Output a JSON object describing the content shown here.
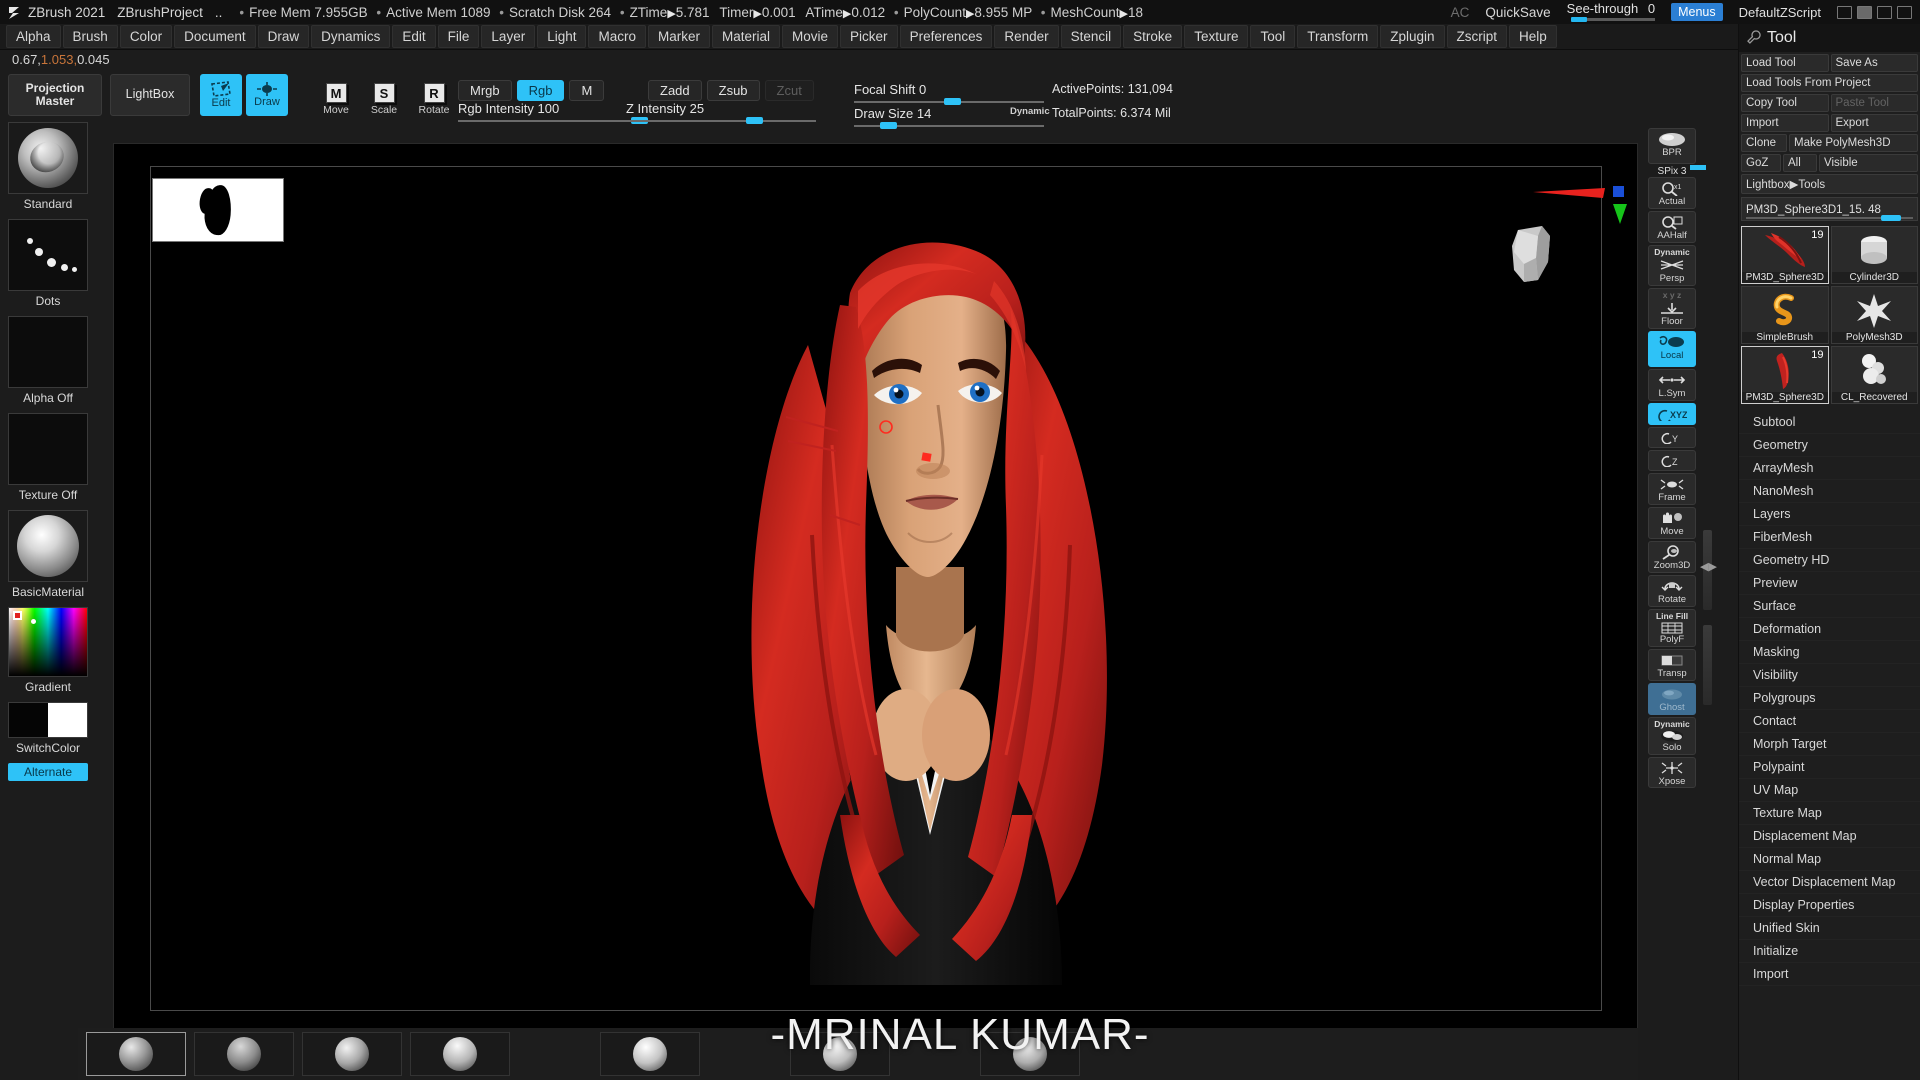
{
  "titlebar": {
    "app": "ZBrush 2021",
    "project": "ZBrushProject",
    "dots": "..",
    "stats": [
      {
        "label": "Free Mem",
        "value": "7.955GB"
      },
      {
        "label": "Active Mem",
        "value": "1089"
      },
      {
        "label": "Scratch Disk",
        "value": "264"
      },
      {
        "label": "ZTime",
        "value": "5.781",
        "arrow": true
      },
      {
        "label": "Timer",
        "value": "0.001",
        "arrow": true
      },
      {
        "label": "ATime",
        "value": "0.012",
        "arrow": true
      },
      {
        "label": "PolyCount",
        "value": "8.955 MP",
        "arrow": true
      },
      {
        "label": "MeshCount",
        "value": "18",
        "arrow": true
      }
    ],
    "ac": "AC",
    "quicksave": "QuickSave",
    "seethrough_label": "See-through",
    "seethrough_value": "0",
    "menus": "Menus",
    "default_zscript": "DefaultZScript"
  },
  "menubar": {
    "items": [
      "Alpha",
      "Brush",
      "Color",
      "Document",
      "Draw",
      "Dynamics",
      "Edit",
      "File",
      "Layer",
      "Light",
      "Macro",
      "Marker",
      "Material",
      "Movie",
      "Picker",
      "Preferences",
      "Render",
      "Stencil",
      "Stroke",
      "Texture",
      "Tool",
      "Transform",
      "Zplugin",
      "Zscript",
      "Help"
    ]
  },
  "coords": {
    "x": "0.67,",
    "y": "1.053,",
    "z": "0.045"
  },
  "toolbar": {
    "projection_master": "Projection Master",
    "lightbox": "LightBox",
    "edit": "Edit",
    "draw": "Draw",
    "move": "Move",
    "scale": "Scale",
    "rotate": "Rotate",
    "mrgb": "Mrgb",
    "rgb": "Rgb",
    "m": "M",
    "zadd": "Zadd",
    "zsub": "Zsub",
    "zcut": "Zcut",
    "rgb_intensity_label": "Rgb Intensity",
    "rgb_intensity_value": "100",
    "z_intensity_label": "Z Intensity",
    "z_intensity_value": "25",
    "focal_shift_label": "Focal Shift",
    "focal_shift_value": "0",
    "draw_size_label": "Draw Size",
    "draw_size_value": "14",
    "dynamic": "Dynamic",
    "active_points": "ActivePoints: 131,094",
    "total_points": "TotalPoints: 6.374 Mil"
  },
  "leftshelf": {
    "brush_label": "Standard",
    "stroke_label": "Dots",
    "alpha_label": "Alpha Off",
    "texture_label": "Texture Off",
    "material_label": "BasicMaterial",
    "gradient_label": "Gradient",
    "switchcolor_label": "SwitchColor",
    "alternate_label": "Alternate"
  },
  "rail": {
    "bpr": "BPR",
    "spix_label": "SPix",
    "spix_value": "3",
    "items": [
      {
        "name": "Actual",
        "active": false
      },
      {
        "name": "AAHalf",
        "active": false
      },
      {
        "name": "Persp",
        "top": "Dynamic",
        "active": false
      },
      {
        "name": "Floor",
        "top": "x y z",
        "active": false
      },
      {
        "name": "Local",
        "active": true
      },
      {
        "name": "L.Sym",
        "active": false
      },
      {
        "name": "XYZ",
        "active": true
      },
      {
        "name": "Y",
        "active": false
      },
      {
        "name": "Z",
        "active": false
      },
      {
        "name": "Frame",
        "active": false
      },
      {
        "name": "Move",
        "active": false
      },
      {
        "name": "Zoom3D",
        "active": false
      },
      {
        "name": "Rotate",
        "active": false
      },
      {
        "name": "PolyF",
        "top": "Line Fill",
        "active": false
      },
      {
        "name": "Transp",
        "active": false
      },
      {
        "name": "Ghost",
        "active": false,
        "ghost": true
      },
      {
        "name": "Solo",
        "top": "Dynamic",
        "active": false
      },
      {
        "name": "Xpose",
        "active": false
      }
    ]
  },
  "toolpanel": {
    "title": "Tool",
    "buttons_row1": [
      "Load Tool",
      "Save As"
    ],
    "buttons_row2": [
      "Load Tools From Project"
    ],
    "buttons_row3": [
      "Copy Tool",
      "Paste Tool"
    ],
    "buttons_row4": [
      "Import",
      "Export"
    ],
    "buttons_row5": [
      "Clone",
      "Make PolyMesh3D"
    ],
    "buttons_row6": [
      "GoZ",
      "All",
      "Visible"
    ],
    "lightbox_tools": "Lightbox▶Tools",
    "slider_label": "PM3D_Sphere3D1_15.",
    "slider_value": "48",
    "tools": [
      {
        "label": "PM3D_Sphere3D",
        "count": "19",
        "selected": true,
        "icon": "red-hair"
      },
      {
        "label": "Cylinder3D",
        "count": "",
        "selected": false,
        "icon": "cylinder"
      },
      {
        "label": "SimpleBrush",
        "count": "",
        "selected": false,
        "icon": "s-brush"
      },
      {
        "label": "PolyMesh3D",
        "count": "",
        "selected": false,
        "icon": "star"
      },
      {
        "label": "PM3D_Sphere3D",
        "count": "19",
        "selected": true,
        "icon": "red-strand"
      },
      {
        "label": "CL_Recovered",
        "count": "",
        "selected": false,
        "icon": "blob"
      }
    ],
    "menu": [
      "Subtool",
      "Geometry",
      "ArrayMesh",
      "NanoMesh",
      "Layers",
      "FiberMesh",
      "Geometry HD",
      "Preview",
      "Surface",
      "Deformation",
      "Masking",
      "Visibility",
      "Polygroups",
      "Contact",
      "Morph Target",
      "Polypaint",
      "UV Map",
      "Texture Map",
      "Displacement Map",
      "Normal Map",
      "Vector Displacement Map",
      "Display Properties",
      "Unified Skin",
      "Initialize",
      "Import"
    ]
  },
  "canvas": {
    "watermark": "-MRINAL KUMAR-"
  },
  "colors": {
    "accent_cyan": "#2ec2f7",
    "panel_bg": "#1e1e1e",
    "title_bg": "#111111",
    "hair_red": "#c0221f"
  }
}
